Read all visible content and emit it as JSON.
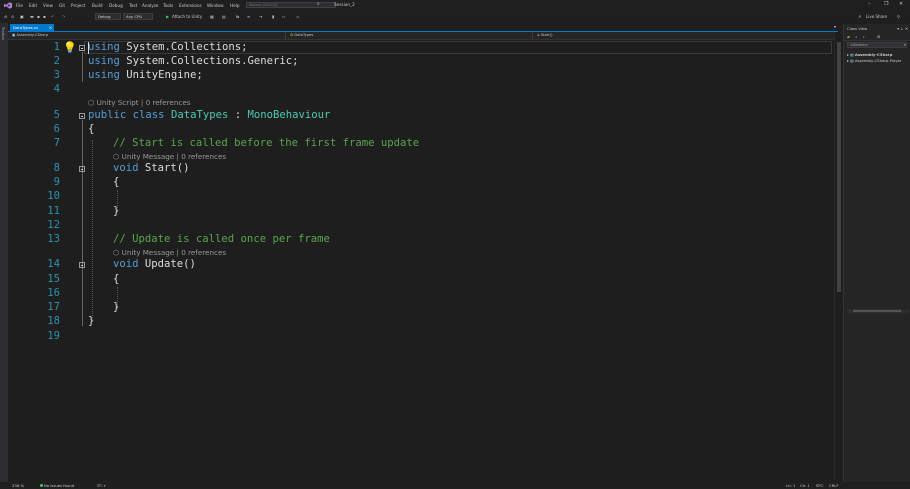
{
  "menubar": {
    "items": [
      "File",
      "Edit",
      "View",
      "Git",
      "Project",
      "Build",
      "Debug",
      "Test",
      "Analyze",
      "Tools",
      "Extensions",
      "Window",
      "Help"
    ],
    "search_placeholder": "Search (Ctrl+Q)",
    "solution_name": "Session_2",
    "live_share": "Live Share"
  },
  "toolbar": {
    "config": "Debug",
    "platform": "Any CPU",
    "attach_label": "Attach to Unity"
  },
  "leftstrip": {
    "label": "Toolbox"
  },
  "tabs": [
    {
      "label": "DataTypes.cs",
      "close": "✕"
    }
  ],
  "nav": {
    "project": "Assembly-CSharp",
    "class": "DataTypes",
    "member": "Start()"
  },
  "editor": {
    "lines": [
      {
        "n": "1"
      },
      {
        "n": "2"
      },
      {
        "n": "3"
      },
      {
        "n": "4"
      },
      {
        "n": "5"
      },
      {
        "n": "6"
      },
      {
        "n": "7"
      },
      {
        "n": "8"
      },
      {
        "n": "9"
      },
      {
        "n": "10"
      },
      {
        "n": "11"
      },
      {
        "n": "12"
      },
      {
        "n": "13"
      },
      {
        "n": "14"
      },
      {
        "n": "15"
      },
      {
        "n": "16"
      },
      {
        "n": "17"
      },
      {
        "n": "18"
      },
      {
        "n": "19"
      }
    ],
    "code": {
      "l1_kw": "using",
      "l1_rest": " System.Collections;",
      "l2_kw": "using",
      "l2_rest": " System.Collections.Generic;",
      "l3_kw": "using",
      "l3_rest": " UnityEngine;",
      "lens_class": "Unity Script | 0 references",
      "l5_kw": "public class",
      "l5_type": "DataTypes",
      "l5_colon": " : ",
      "l5_base": "MonoBehaviour",
      "l6": "{",
      "l7_comment": "// Start is called before the first frame update",
      "lens_start": "Unity Message | 0 references",
      "l8_kw": "void",
      "l8_rest": " Start()",
      "l9": "{",
      "l11": "}",
      "l13_comment": "// Update is called once per frame",
      "lens_update": "Unity Message | 0 references",
      "l14_kw": "void",
      "l14_rest": " Update()",
      "l15": "{",
      "l17": "}",
      "l18": "}"
    }
  },
  "classview": {
    "title": "Class View",
    "search_placeholder": "<Search>",
    "items": [
      "Assembly-CSharp",
      "Assembly-CSharp-Player"
    ]
  },
  "status": {
    "zoom": "236 %",
    "issues": "No issues found",
    "ln": "Ln: 1",
    "ch": "Ch: 1",
    "spc": "SPC",
    "crlf": "CRLF"
  },
  "colors": {
    "accent": "#007acc",
    "keyword": "#569cd6",
    "type": "#4ec9b0",
    "comment": "#57a64a",
    "line_number": "#2b91af"
  }
}
